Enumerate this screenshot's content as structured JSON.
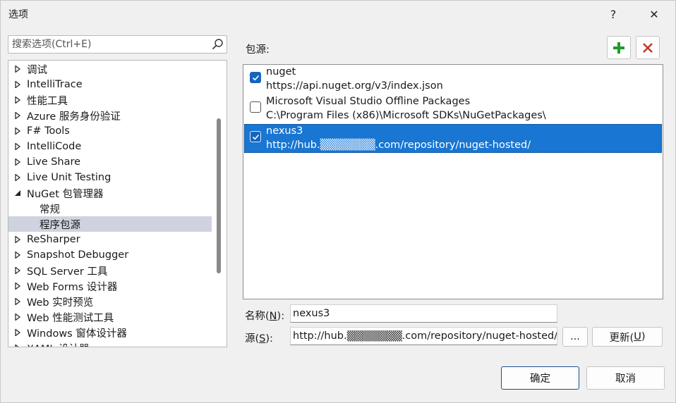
{
  "window": {
    "title": "选项",
    "help": "?",
    "close": "✕"
  },
  "search": {
    "placeholder": "搜索选项(Ctrl+E)"
  },
  "tree": {
    "items": [
      {
        "label": "调试",
        "state": "collapsed"
      },
      {
        "label": "IntelliTrace",
        "state": "collapsed"
      },
      {
        "label": "性能工具",
        "state": "collapsed"
      },
      {
        "label": "Azure 服务身份验证",
        "state": "collapsed"
      },
      {
        "label": "F# Tools",
        "state": "collapsed"
      },
      {
        "label": "IntelliCode",
        "state": "collapsed"
      },
      {
        "label": "Live Share",
        "state": "collapsed"
      },
      {
        "label": "Live Unit Testing",
        "state": "collapsed"
      },
      {
        "label": "NuGet 包管理器",
        "state": "expanded"
      },
      {
        "label": "常规",
        "state": "child"
      },
      {
        "label": "程序包源",
        "state": "child-selected"
      },
      {
        "label": "ReSharper",
        "state": "collapsed"
      },
      {
        "label": "Snapshot Debugger",
        "state": "collapsed"
      },
      {
        "label": "SQL Server 工具",
        "state": "collapsed"
      },
      {
        "label": "Web Forms 设计器",
        "state": "collapsed"
      },
      {
        "label": "Web 实时预览",
        "state": "collapsed"
      },
      {
        "label": "Web 性能测试工具",
        "state": "collapsed"
      },
      {
        "label": "Windows 窗体设计器",
        "state": "collapsed"
      },
      {
        "label": "XAML 设计器",
        "state": "collapsed"
      }
    ]
  },
  "sources": {
    "label": "包源:",
    "items": [
      {
        "name": "nuget",
        "url": "https://api.nuget.org/v3/index.json",
        "checked": true,
        "selected": false
      },
      {
        "name": "Microsoft Visual Studio Offline Packages",
        "url": "C:\\Program Files (x86)\\Microsoft SDKs\\NuGetPackages\\",
        "checked": false,
        "selected": false
      },
      {
        "name": "nexus3",
        "url": "http://hub.▒▒▒▒▒▒▒.com/repository/nuget-hosted/",
        "checked": true,
        "selected": true
      }
    ]
  },
  "form": {
    "name_label_pre": "名称(",
    "name_label_key": "N",
    "name_label_post": "):",
    "name_value": "nexus3",
    "source_label_pre": "源(",
    "source_label_key": "S",
    "source_label_post": "):",
    "source_value": "http://hub.▒▒▒▒▒▒▒.com/repository/nuget-hosted/",
    "browse": "...",
    "update_pre": "更新(",
    "update_key": "U",
    "update_post": ")"
  },
  "buttons": {
    "ok": "确定",
    "cancel": "取消"
  },
  "colors": {
    "accent": "#1976d2",
    "add_icon": "#1e9b2e",
    "remove_icon": "#c0392b"
  }
}
